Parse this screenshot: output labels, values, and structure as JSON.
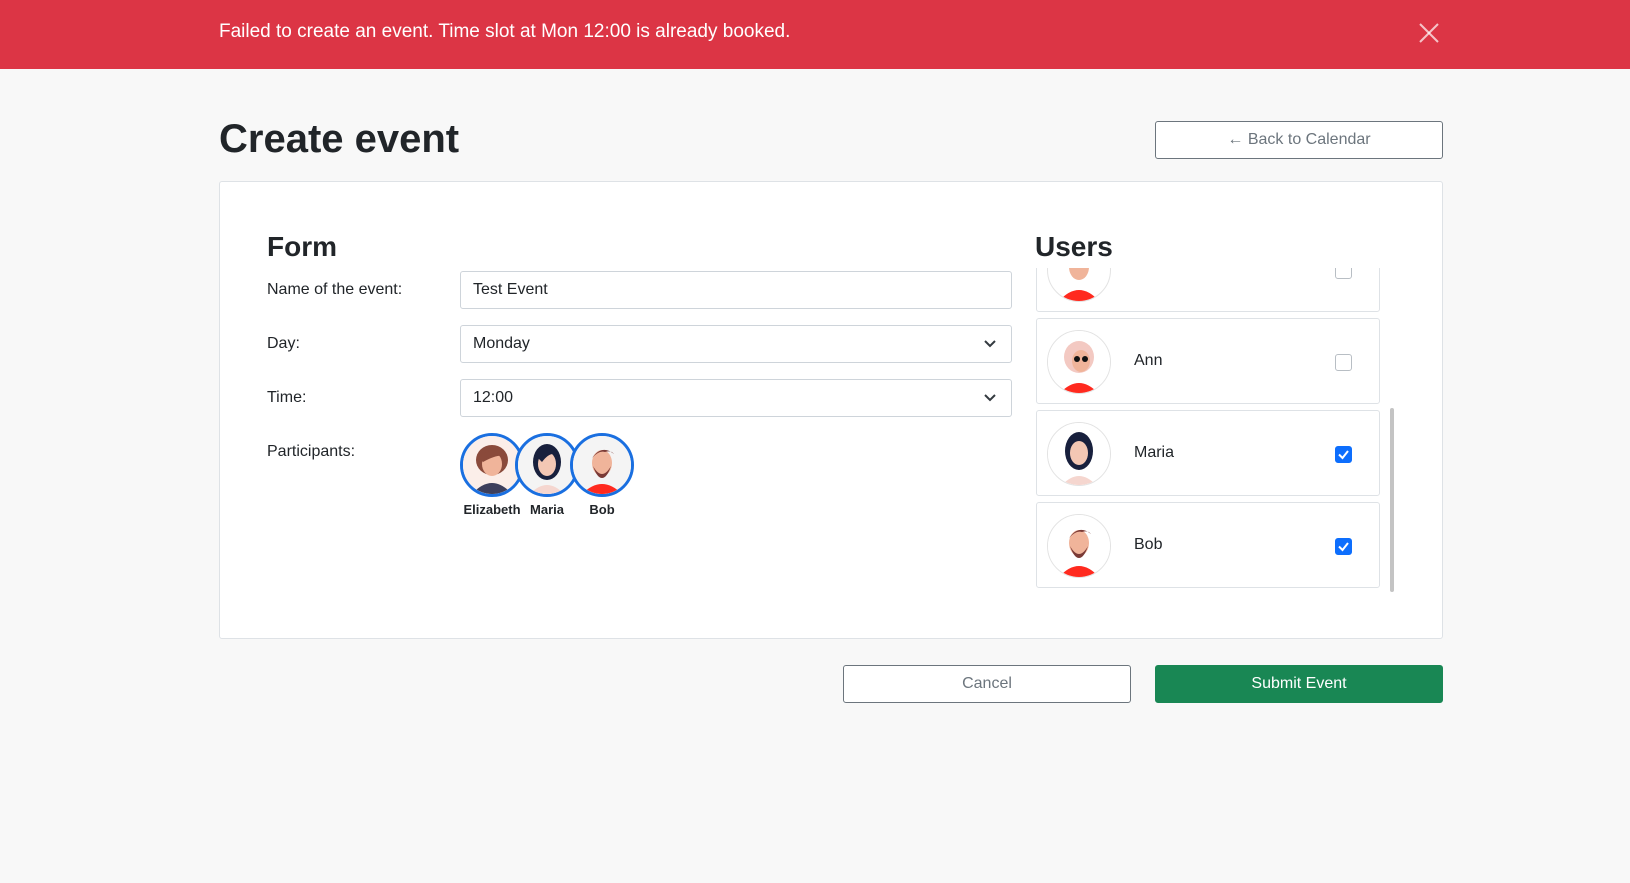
{
  "alert": {
    "message": "Failed to create an event. Time slot at Mon 12:00 is already booked.",
    "color": "#dc3545"
  },
  "header": {
    "title": "Create event",
    "back_label": "← Back to Calendar"
  },
  "form": {
    "title": "Form",
    "name_label": "Name of the event:",
    "name_value": "Test Event",
    "day_label": "Day:",
    "day_value": "Monday",
    "time_label": "Time:",
    "time_value": "12:00",
    "participants_label": "Participants:",
    "participants": [
      {
        "name": "Elizabeth",
        "avatar": "elizabeth-avatar"
      },
      {
        "name": "Maria",
        "avatar": "maria-avatar"
      },
      {
        "name": "Bob",
        "avatar": "bob-avatar"
      }
    ]
  },
  "users": {
    "title": "Users",
    "items": [
      {
        "name": "",
        "checked": false,
        "avatar": "user-avatar"
      },
      {
        "name": "Ann",
        "checked": false,
        "avatar": "ann-avatar"
      },
      {
        "name": "Maria",
        "checked": true,
        "avatar": "maria-avatar"
      },
      {
        "name": "Bob",
        "checked": true,
        "avatar": "bob-avatar"
      }
    ]
  },
  "footer": {
    "cancel_label": "Cancel",
    "submit_label": "Submit Event",
    "submit_color": "#198754",
    "accent_color": "#0d6efd"
  }
}
